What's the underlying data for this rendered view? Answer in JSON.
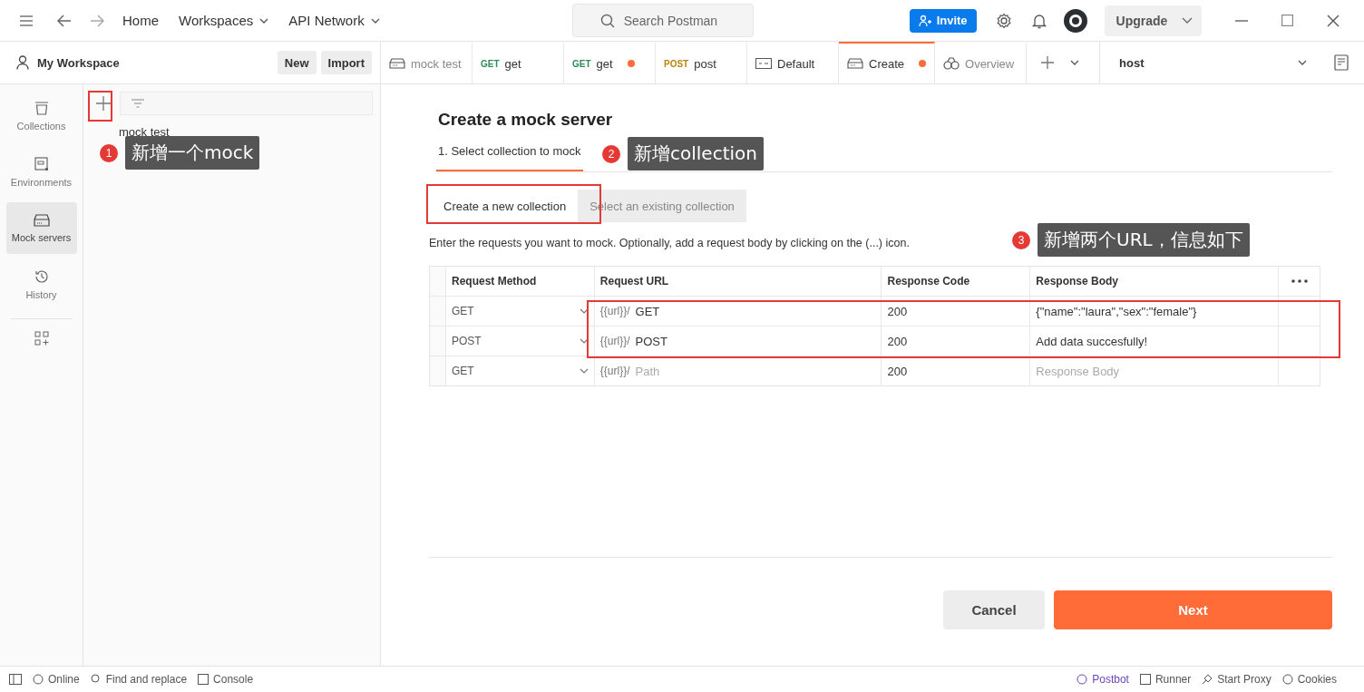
{
  "topbar": {
    "nav": [
      {
        "label": "Home",
        "caret": false
      },
      {
        "label": "Workspaces",
        "caret": true
      },
      {
        "label": "API Network",
        "caret": true
      }
    ],
    "search": {
      "placeholder": "Search Postman"
    },
    "invite": "Invite",
    "upgrade": "Upgrade"
  },
  "workspace": {
    "name": "My Workspace",
    "buttons": [
      "New",
      "Import"
    ]
  },
  "tabs": [
    {
      "kind": "mock",
      "label": "mock test",
      "selected": false,
      "unsaved": false
    },
    {
      "kind": "request",
      "method": "GET",
      "color": "#2e8b57",
      "label": "get",
      "selected": false,
      "unsaved": false
    },
    {
      "kind": "request",
      "method": "GET",
      "color": "#2e8b57",
      "label": "get",
      "selected": false,
      "unsaved": true
    },
    {
      "kind": "request",
      "method": "POST",
      "color": "#b8860b",
      "label": "post",
      "selected": false,
      "unsaved": false
    },
    {
      "kind": "environment",
      "label": "Default",
      "selected": false,
      "unsaved": false
    },
    {
      "kind": "mock",
      "label": "Create",
      "selected": true,
      "unsaved": true
    },
    {
      "kind": "overview",
      "label": "Overview",
      "selected": false,
      "unsaved": false
    }
  ],
  "environment": "host",
  "rail": [
    {
      "kind": "collections",
      "label": "Collections",
      "selected": false
    },
    {
      "kind": "environments",
      "label": "Environments",
      "selected": false
    },
    {
      "kind": "mock",
      "label": "Mock servers",
      "selected": true
    },
    {
      "kind": "history",
      "label": "History",
      "selected": false
    }
  ],
  "sidebar": {
    "items": [
      "mock test"
    ]
  },
  "main": {
    "title": "Create a mock server",
    "steps": [
      {
        "label": "1. Select collection to mock",
        "selected": true
      }
    ],
    "options": [
      {
        "label": "Create a new collection",
        "selected": true
      },
      {
        "label": "Select an existing collection",
        "selected": false
      }
    ],
    "instruction": "Enter the requests you want to mock. Optionally, add a request body by clicking on the (...) icon.",
    "columns": [
      "Request Method",
      "Request URL",
      "Response Code",
      "Response Body"
    ],
    "rows": [
      {
        "method": "GET",
        "prefix": "{{url}}/",
        "path": "GET",
        "code": "200",
        "body": "{\"name\":\"laura\",\"sex\":\"female\"}"
      },
      {
        "method": "POST",
        "prefix": "{{url}}/",
        "path": "POST",
        "code": "200",
        "body": "Add data succesfully!"
      },
      {
        "method": "GET",
        "prefix": "{{url}}/",
        "path_placeholder": "Path",
        "code": "200",
        "body_placeholder": "Response Body"
      }
    ],
    "buttons": {
      "cancel": "Cancel",
      "next": "Next"
    }
  },
  "callouts": [
    {
      "number": "1",
      "text": "新增一个mock"
    },
    {
      "number": "2",
      "text": "新增collection"
    },
    {
      "number": "3",
      "text": "新增两个URL，信息如下"
    }
  ],
  "status": {
    "left": [
      {
        "kind": "online",
        "label": "Online"
      },
      {
        "kind": "find",
        "label": "Find and replace"
      },
      {
        "kind": "console",
        "label": "Console"
      }
    ],
    "right": [
      {
        "kind": "postbot",
        "label": "Postbot"
      },
      {
        "kind": "runner",
        "label": "Runner"
      },
      {
        "kind": "proxy",
        "label": "Start Proxy"
      },
      {
        "kind": "cookies",
        "label": "Cookies"
      }
    ]
  }
}
